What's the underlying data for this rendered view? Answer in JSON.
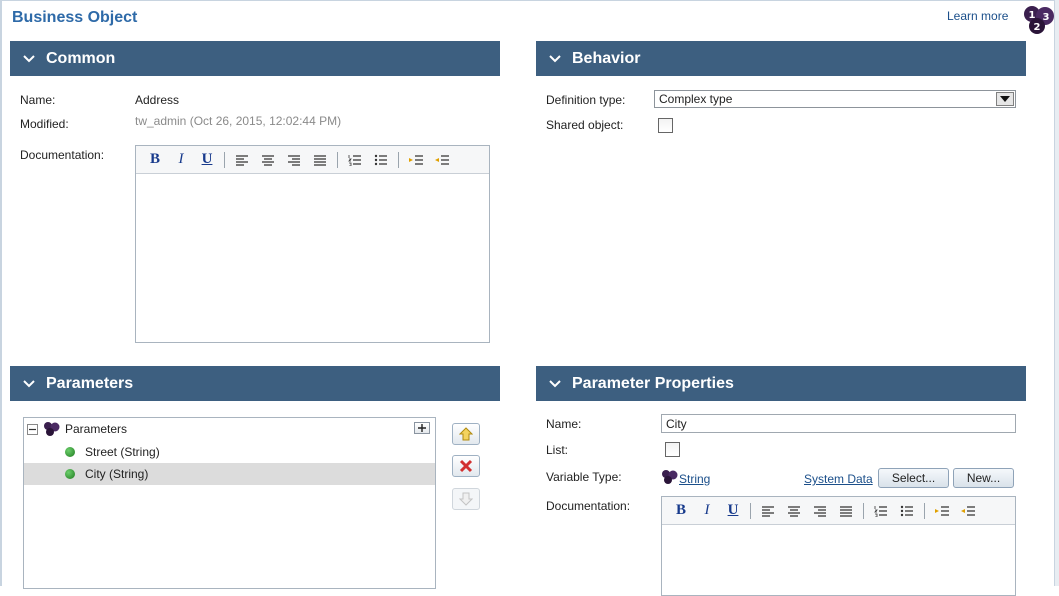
{
  "page": {
    "title": "Business Object",
    "learn_more": "Learn more"
  },
  "colors": {
    "header_bg": "#3d5f80",
    "title": "#2e6aa8",
    "link": "#1b4f8a"
  },
  "common": {
    "header": "Common",
    "name_label": "Name:",
    "name_value": "Address",
    "modified_label": "Modified:",
    "modified_value": "tw_admin (Oct 26, 2015, 12:02:44 PM)",
    "documentation_label": "Documentation:"
  },
  "behavior": {
    "header": "Behavior",
    "definition_type_label": "Definition type:",
    "definition_type_value": "Complex type",
    "shared_object_label": "Shared object:"
  },
  "parameters": {
    "header": "Parameters",
    "root_label": "Parameters",
    "items": [
      {
        "label": "Street (String)"
      },
      {
        "label": "City (String)"
      }
    ]
  },
  "parameter_properties": {
    "header": "Parameter Properties",
    "name_label": "Name:",
    "name_value": "City",
    "list_label": "List:",
    "variable_type_label": "Variable Type:",
    "variable_type_value": "String",
    "system_data_link": "System Data",
    "select_button": "Select...",
    "new_button": "New...",
    "documentation_label": "Documentation:"
  },
  "toolbar": {
    "bold": "B",
    "italic": "I",
    "underline": "U"
  }
}
